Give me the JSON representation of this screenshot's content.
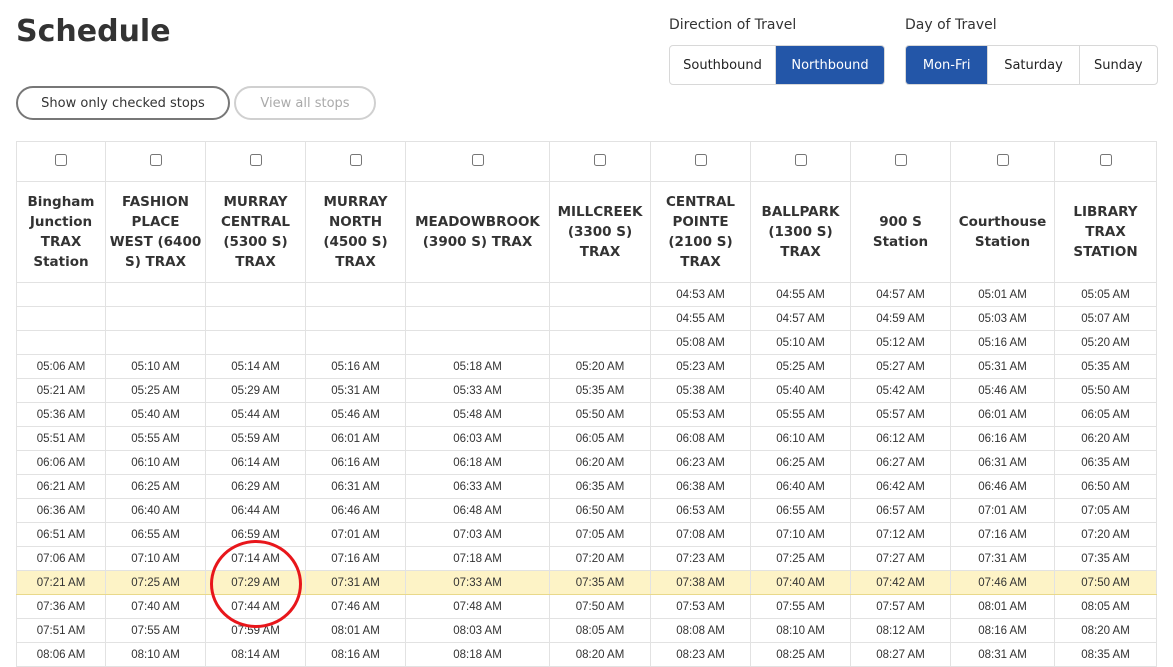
{
  "page": {
    "title": "Schedule"
  },
  "filters": {
    "show_checked_label": "Show only checked stops",
    "view_all_label": "View all stops"
  },
  "direction": {
    "label": "Direction of Travel",
    "options": [
      "Southbound",
      "Northbound"
    ],
    "selected": "Northbound"
  },
  "day": {
    "label": "Day of Travel",
    "options": [
      "Mon-Fri",
      "Saturday",
      "Sunday"
    ],
    "selected": "Mon-Fri"
  },
  "colors": {
    "accent": "#2356a8",
    "highlight_row": "#fdf3c6",
    "annotation_circle": "#e8161b"
  },
  "table": {
    "stops": [
      "Bingham Junction TRAX Station",
      "FASHION PLACE WEST (6400 S) TRAX",
      "MURRAY CENTRAL (5300 S) TRAX",
      "MURRAY NORTH (4500 S) TRAX",
      "MEADOWBROOK (3900 S) TRAX",
      "MILLCREEK (3300 S) TRAX",
      "CENTRAL POINTE (2100 S) TRAX",
      "BALLPARK (1300 S) TRAX",
      "900 S Station",
      "Courthouse Station",
      "LIBRARY TRAX STATION"
    ],
    "highlighted_row_index": 12,
    "rows": [
      [
        "",
        "",
        "",
        "",
        "",
        "",
        "04:53 AM",
        "04:55 AM",
        "04:57 AM",
        "05:01 AM",
        "05:05 AM"
      ],
      [
        "",
        "",
        "",
        "",
        "",
        "",
        "04:55 AM",
        "04:57 AM",
        "04:59 AM",
        "05:03 AM",
        "05:07 AM"
      ],
      [
        "",
        "",
        "",
        "",
        "",
        "",
        "05:08 AM",
        "05:10 AM",
        "05:12 AM",
        "05:16 AM",
        "05:20 AM"
      ],
      [
        "05:06 AM",
        "05:10 AM",
        "05:14 AM",
        "05:16 AM",
        "05:18 AM",
        "05:20 AM",
        "05:23 AM",
        "05:25 AM",
        "05:27 AM",
        "05:31 AM",
        "05:35 AM"
      ],
      [
        "05:21 AM",
        "05:25 AM",
        "05:29 AM",
        "05:31 AM",
        "05:33 AM",
        "05:35 AM",
        "05:38 AM",
        "05:40 AM",
        "05:42 AM",
        "05:46 AM",
        "05:50 AM"
      ],
      [
        "05:36 AM",
        "05:40 AM",
        "05:44 AM",
        "05:46 AM",
        "05:48 AM",
        "05:50 AM",
        "05:53 AM",
        "05:55 AM",
        "05:57 AM",
        "06:01 AM",
        "06:05 AM"
      ],
      [
        "05:51 AM",
        "05:55 AM",
        "05:59 AM",
        "06:01 AM",
        "06:03 AM",
        "06:05 AM",
        "06:08 AM",
        "06:10 AM",
        "06:12 AM",
        "06:16 AM",
        "06:20 AM"
      ],
      [
        "06:06 AM",
        "06:10 AM",
        "06:14 AM",
        "06:16 AM",
        "06:18 AM",
        "06:20 AM",
        "06:23 AM",
        "06:25 AM",
        "06:27 AM",
        "06:31 AM",
        "06:35 AM"
      ],
      [
        "06:21 AM",
        "06:25 AM",
        "06:29 AM",
        "06:31 AM",
        "06:33 AM",
        "06:35 AM",
        "06:38 AM",
        "06:40 AM",
        "06:42 AM",
        "06:46 AM",
        "06:50 AM"
      ],
      [
        "06:36 AM",
        "06:40 AM",
        "06:44 AM",
        "06:46 AM",
        "06:48 AM",
        "06:50 AM",
        "06:53 AM",
        "06:55 AM",
        "06:57 AM",
        "07:01 AM",
        "07:05 AM"
      ],
      [
        "06:51 AM",
        "06:55 AM",
        "06:59 AM",
        "07:01 AM",
        "07:03 AM",
        "07:05 AM",
        "07:08 AM",
        "07:10 AM",
        "07:12 AM",
        "07:16 AM",
        "07:20 AM"
      ],
      [
        "07:06 AM",
        "07:10 AM",
        "07:14 AM",
        "07:16 AM",
        "07:18 AM",
        "07:20 AM",
        "07:23 AM",
        "07:25 AM",
        "07:27 AM",
        "07:31 AM",
        "07:35 AM"
      ],
      [
        "07:21 AM",
        "07:25 AM",
        "07:29 AM",
        "07:31 AM",
        "07:33 AM",
        "07:35 AM",
        "07:38 AM",
        "07:40 AM",
        "07:42 AM",
        "07:46 AM",
        "07:50 AM"
      ],
      [
        "07:36 AM",
        "07:40 AM",
        "07:44 AM",
        "07:46 AM",
        "07:48 AM",
        "07:50 AM",
        "07:53 AM",
        "07:55 AM",
        "07:57 AM",
        "08:01 AM",
        "08:05 AM"
      ],
      [
        "07:51 AM",
        "07:55 AM",
        "07:59 AM",
        "08:01 AM",
        "08:03 AM",
        "08:05 AM",
        "08:08 AM",
        "08:10 AM",
        "08:12 AM",
        "08:16 AM",
        "08:20 AM"
      ],
      [
        "08:06 AM",
        "08:10 AM",
        "08:14 AM",
        "08:16 AM",
        "08:18 AM",
        "08:20 AM",
        "08:23 AM",
        "08:25 AM",
        "08:27 AM",
        "08:31 AM",
        "08:35 AM"
      ]
    ]
  }
}
